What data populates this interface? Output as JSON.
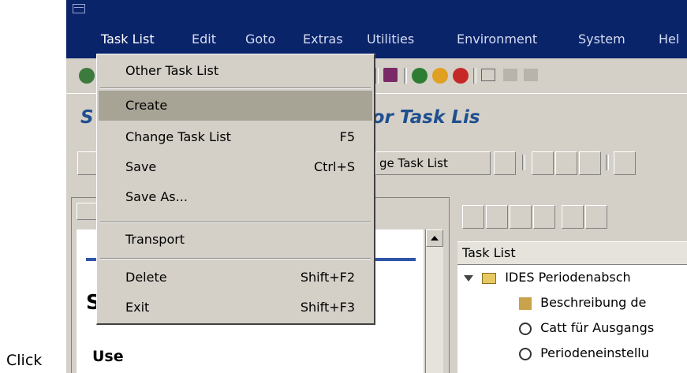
{
  "instruction": "Click",
  "menubar": {
    "items": [
      "Task List",
      "Edit",
      "Goto",
      "Extras",
      "Utilities",
      "Environment",
      "System",
      "Hel"
    ]
  },
  "title": "S        edule Tasks for Task Lis",
  "app_toolbar": {
    "change_button": "ge Task List"
  },
  "dropdown": {
    "items": [
      {
        "label": "Other Task List",
        "shortcut": ""
      },
      {
        "label": "Create",
        "shortcut": ""
      },
      {
        "label": "Change Task List",
        "shortcut": "F5"
      },
      {
        "label": "Save",
        "shortcut": "Ctrl+S"
      },
      {
        "label": "Save As...",
        "shortcut": ""
      },
      {
        "label": "Transport",
        "shortcut": ""
      },
      {
        "label": "Delete",
        "shortcut": "Shift+F2"
      },
      {
        "label": "Exit",
        "shortcut": "Shift+F3"
      }
    ]
  },
  "left_panel": {
    "heading_letter": "S",
    "use_label": "Use"
  },
  "right_panel": {
    "column_header": "Task List",
    "tree": [
      "IDES Periodenabsch",
      "Beschreibung de",
      "Catt für Ausgangs",
      "Periodeneinstellu"
    ]
  }
}
